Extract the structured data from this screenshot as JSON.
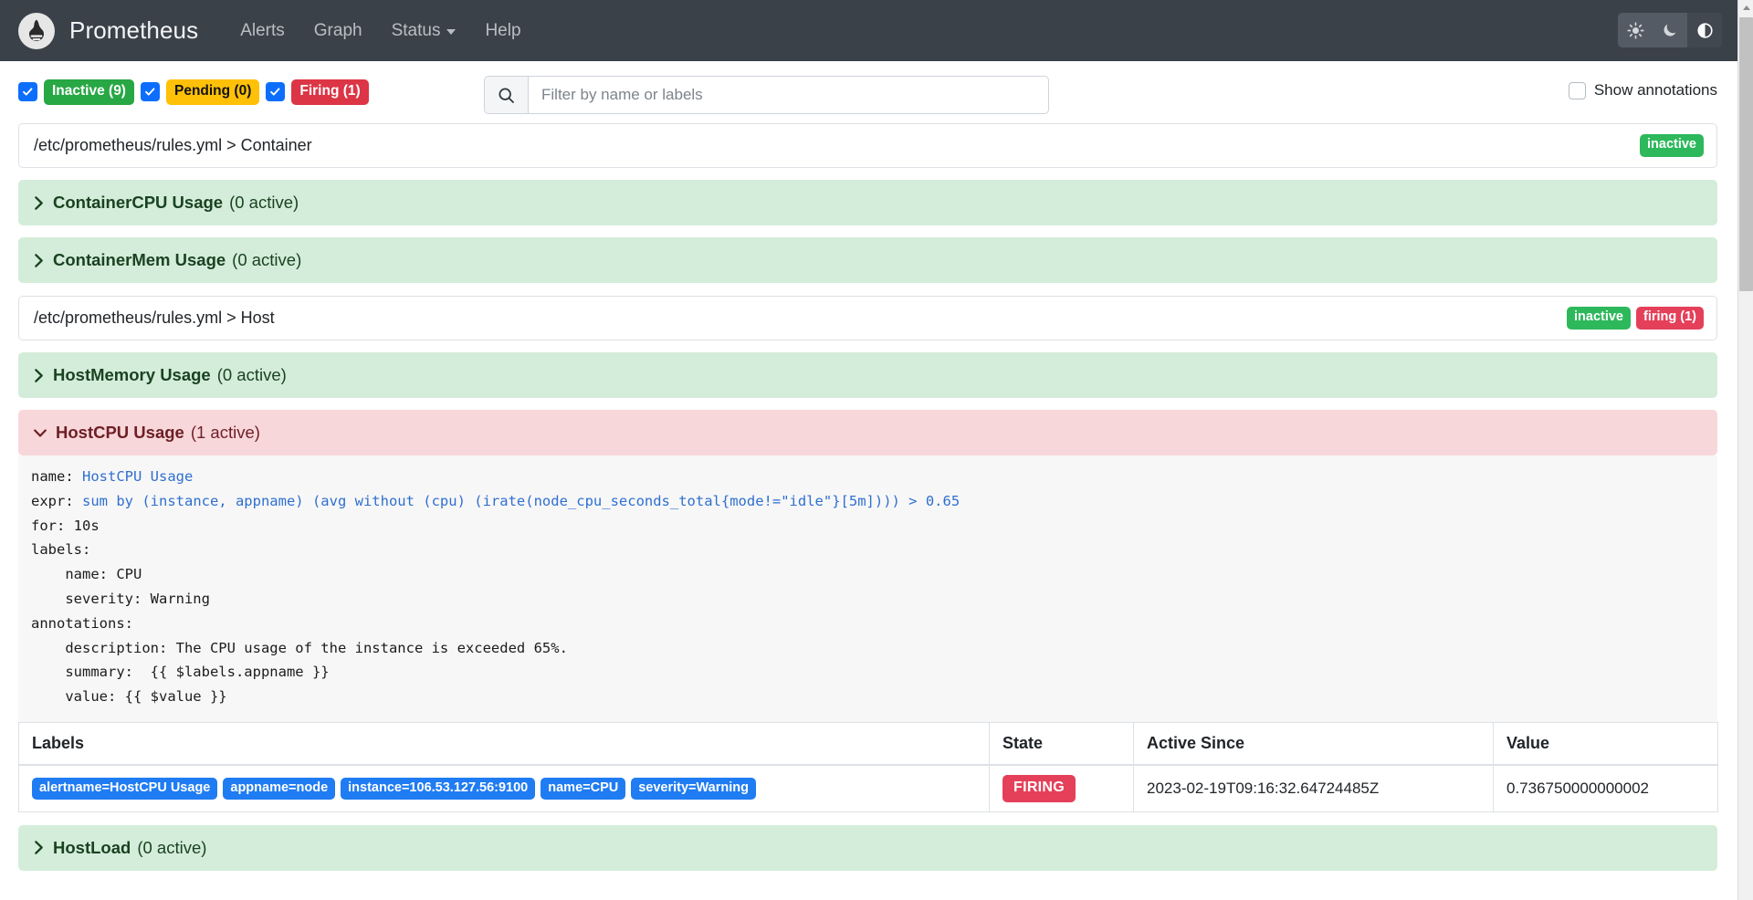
{
  "navbar": {
    "brand": "Prometheus",
    "logo_icon": "prometheus-torch-logo",
    "links": [
      {
        "label": "Alerts",
        "icon": ""
      },
      {
        "label": "Graph",
        "icon": ""
      },
      {
        "label": "Status",
        "icon": "chevron-down-icon"
      },
      {
        "label": "Help",
        "icon": ""
      }
    ],
    "theme_buttons": [
      {
        "icon": "sun-icon",
        "name": "light-theme",
        "active": false
      },
      {
        "icon": "moon-icon",
        "name": "dark-theme",
        "active": false
      },
      {
        "icon": "half-circle-icon",
        "name": "auto-theme",
        "active": true
      }
    ]
  },
  "toolbar": {
    "filters": [
      {
        "label": "Inactive (9)",
        "state": "inactive",
        "checked": true,
        "color": "#28a745"
      },
      {
        "label": "Pending (0)",
        "state": "pending",
        "checked": true,
        "color": "#ffc107"
      },
      {
        "label": "Firing (1)",
        "state": "firing",
        "checked": true,
        "color": "#dc3545"
      }
    ],
    "search": {
      "icon": "search-icon",
      "placeholder": "Filter by name or labels",
      "value": ""
    },
    "annotations": {
      "label": "Show annotations",
      "checked": false
    }
  },
  "groups": [
    {
      "path": "/etc/prometheus/rules.yml > Container",
      "badges": [
        {
          "label": "inactive",
          "kind": "inactive"
        }
      ],
      "rules": [
        {
          "name": "ContainerCPU Usage",
          "count": "(0 active)",
          "state": "inactive",
          "expanded": false,
          "chevron": "chevron-right-icon"
        },
        {
          "name": "ContainerMem Usage",
          "count": "(0 active)",
          "state": "inactive",
          "expanded": false,
          "chevron": "chevron-right-icon"
        }
      ]
    },
    {
      "path": "/etc/prometheus/rules.yml > Host",
      "badges": [
        {
          "label": "inactive",
          "kind": "inactive"
        },
        {
          "label": "firing (1)",
          "kind": "firing"
        }
      ],
      "rules": [
        {
          "name": "HostMemory Usage",
          "count": "(0 active)",
          "state": "inactive",
          "expanded": false,
          "chevron": "chevron-right-icon"
        },
        {
          "name": "HostCPU Usage",
          "count": "(1 active)",
          "state": "firing",
          "expanded": true,
          "chevron": "chevron-down-icon"
        },
        {
          "name": "HostLoad",
          "count": "(0 active)",
          "state": "inactive",
          "expanded": false,
          "chevron": "chevron-right-icon"
        }
      ]
    }
  ],
  "rule_detail": {
    "yaml_lines": [
      {
        "key": "name: ",
        "value": "HostCPU Usage",
        "indent": 0
      },
      {
        "key": "expr: ",
        "value": "sum by (instance, appname) (avg without (cpu) (irate(node_cpu_seconds_total{mode!=\"idle\"}[5m]))) > 0.65",
        "indent": 0
      },
      {
        "key": "for: ",
        "value": "10s",
        "indent": 0,
        "plain": true
      },
      {
        "key": "labels:",
        "value": "",
        "indent": 0,
        "plain": true
      },
      {
        "key": "  name: CPU",
        "value": "",
        "indent": 1,
        "plain": true
      },
      {
        "key": "  severity: Warning",
        "value": "",
        "indent": 1,
        "plain": true
      },
      {
        "key": "annotations:",
        "value": "",
        "indent": 0,
        "plain": true
      },
      {
        "key": "  description: The CPU usage of the instance is exceeded 65%.",
        "value": "",
        "indent": 1,
        "plain": true
      },
      {
        "key": "  summary:  {{ $labels.appname }}",
        "value": "",
        "indent": 1,
        "plain": true
      },
      {
        "key": "  value: {{ $value }}",
        "value": "",
        "indent": 1,
        "plain": true
      }
    ],
    "table": {
      "columns": [
        "Labels",
        "State",
        "Active Since",
        "Value"
      ],
      "rows": [
        {
          "labels": [
            "alertname=HostCPU Usage",
            "appname=node",
            "instance=106.53.127.56:9100",
            "name=CPU",
            "severity=Warning"
          ],
          "state": "FIRING",
          "active_since": "2023-02-19T09:16:32.64724485Z",
          "value": "0.736750000000002"
        }
      ]
    }
  },
  "colors": {
    "navbar_bg": "#3b4149",
    "inactive_green": "#28a745",
    "pending_yellow": "#ffc107",
    "firing_red": "#dc3545",
    "rule_green_bg": "#d4edda",
    "rule_red_bg": "#f8d7da",
    "label_chip_blue": "#1f7cf2",
    "expr_blue": "#2f6fd0"
  }
}
